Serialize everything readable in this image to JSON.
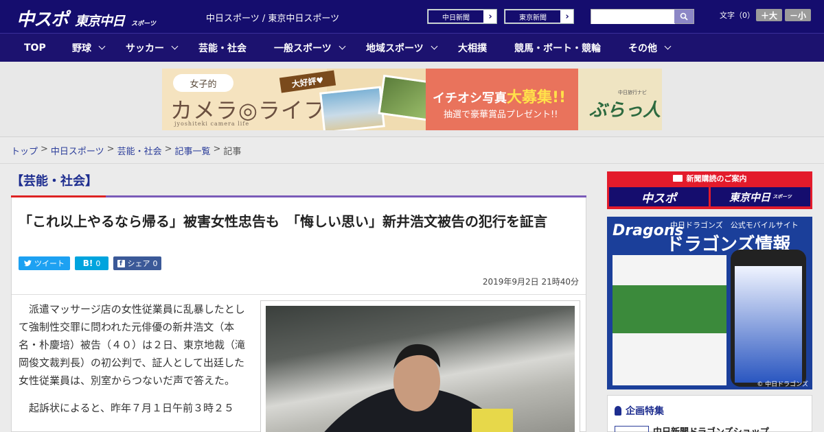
{
  "header": {
    "logo_chunichi_sports": "中スポ",
    "logo_tokyo_chunichi": "東京中日",
    "logo_sports_small": "スポーツ",
    "site_name": "中日スポーツ / 東京中日スポーツ",
    "ext_links": [
      {
        "label": "中日新聞"
      },
      {
        "label": "東京新聞"
      }
    ],
    "search": {
      "placeholder": ""
    },
    "font_size_label": "文字（0）",
    "font_bigger": "＋大",
    "font_smaller": "－小"
  },
  "nav": {
    "items": [
      {
        "label": "TOP",
        "dropdown": false
      },
      {
        "label": "野球",
        "dropdown": true
      },
      {
        "label": "サッカー",
        "dropdown": true
      },
      {
        "label": "芸能・社会",
        "dropdown": false
      },
      {
        "label": "一般スポーツ",
        "dropdown": true
      },
      {
        "label": "地域スポーツ",
        "dropdown": true
      },
      {
        "label": "大相撲",
        "dropdown": false
      },
      {
        "label": "競馬・ボート・競輪",
        "dropdown": false
      },
      {
        "label": "その他",
        "dropdown": true
      }
    ]
  },
  "banner": {
    "pill": "女子的",
    "title": "カメラ◎ライフ",
    "subtitle": "jyoshiteki camera life",
    "tag": "大好評♥",
    "headline_pre": "イチオシ写真",
    "headline_big": "大募集!!",
    "line2": "抽選で豪華賞品プレゼント!!",
    "navi": "中日旅行ナビ",
    "brand": "ぶらっ人"
  },
  "breadcrumb": {
    "items": [
      "トップ",
      "中日スポーツ",
      "芸能・社会",
      "記事一覧"
    ],
    "current": "記事",
    "separator": ">"
  },
  "article": {
    "category": "【芸能・社会】",
    "headline": "「これ以上やるなら帰る」被害女性忠告も　「悔しい思い」新井浩文被告の犯行を証言",
    "share": {
      "tweet": "ツイート",
      "hatena": "B!",
      "hatena_count": "0",
      "facebook": "シェア",
      "facebook_count": "0"
    },
    "date": "2019年9月2日 21時40分",
    "paragraphs": [
      "派遣マッサージ店の女性従業員に乱暴したとして強制性交罪に問われた元俳優の新井浩文（本名・朴慶培）被告（４０）は２日、東京地裁（滝岡俊文裁判長）の初公判で、証人として出廷した女性従業員は、別室からつないだ声で答えた。",
      "起訴状によると、昨年７月１日午前３時２５"
    ]
  },
  "sidebar": {
    "subscribe_header": "新聞購読のご案内",
    "subscribe_left": "中スポ",
    "subscribe_right": "東京中日",
    "subscribe_right_small": "スポーツ",
    "dragons_logo": "Dragons",
    "dragons_tagline": "中日ドラゴンズ　公式モバイルサイト",
    "dragons_title": "ドラゴンズ情報",
    "dragons_copyright": "© 中日ドラゴンズ",
    "special_header": "企画特集",
    "special_item": "中日新聞ドラゴンズショップ"
  },
  "colors": {
    "header_bg": "#150d6e",
    "nav_bg": "#1c126f",
    "accent_red": "#d22",
    "twitter": "#1da1f2",
    "hatena": "#00a4de",
    "facebook": "#3b5998"
  }
}
